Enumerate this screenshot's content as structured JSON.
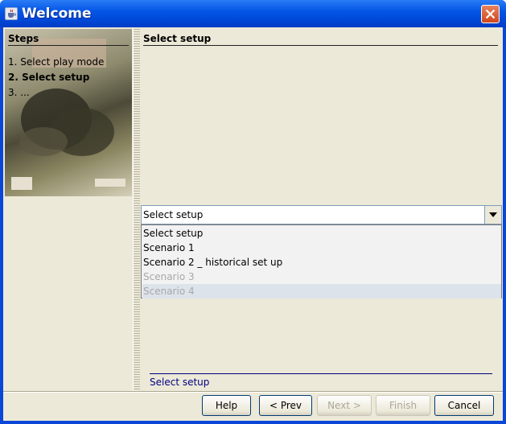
{
  "window": {
    "title": "Welcome",
    "title_icon": "java-cup-icon",
    "close_icon": "close-icon"
  },
  "steps": {
    "header": "Steps",
    "items": [
      "1. Select play mode",
      "2. Select setup",
      "3. ..."
    ],
    "active_index": 1
  },
  "content": {
    "title": "Select setup",
    "combo": {
      "value": "Select setup",
      "arrow_icon": "chevron-down-icon"
    },
    "options": [
      "Select setup",
      "Scenario 1",
      "Scenario 2 _ historical set up",
      "Scenario 3",
      "Scenario 4"
    ],
    "disabled_options": [
      "Scenario 3",
      "Scenario 4"
    ],
    "status": "Select setup"
  },
  "buttons": {
    "help": "Help",
    "prev": "< Prev",
    "next": "Next >",
    "finish": "Finish",
    "cancel": "Cancel"
  },
  "colors": {
    "titlebar": "#0054e3",
    "face": "#ece9d8",
    "status_text": "#000080",
    "close": "#d2461c"
  }
}
